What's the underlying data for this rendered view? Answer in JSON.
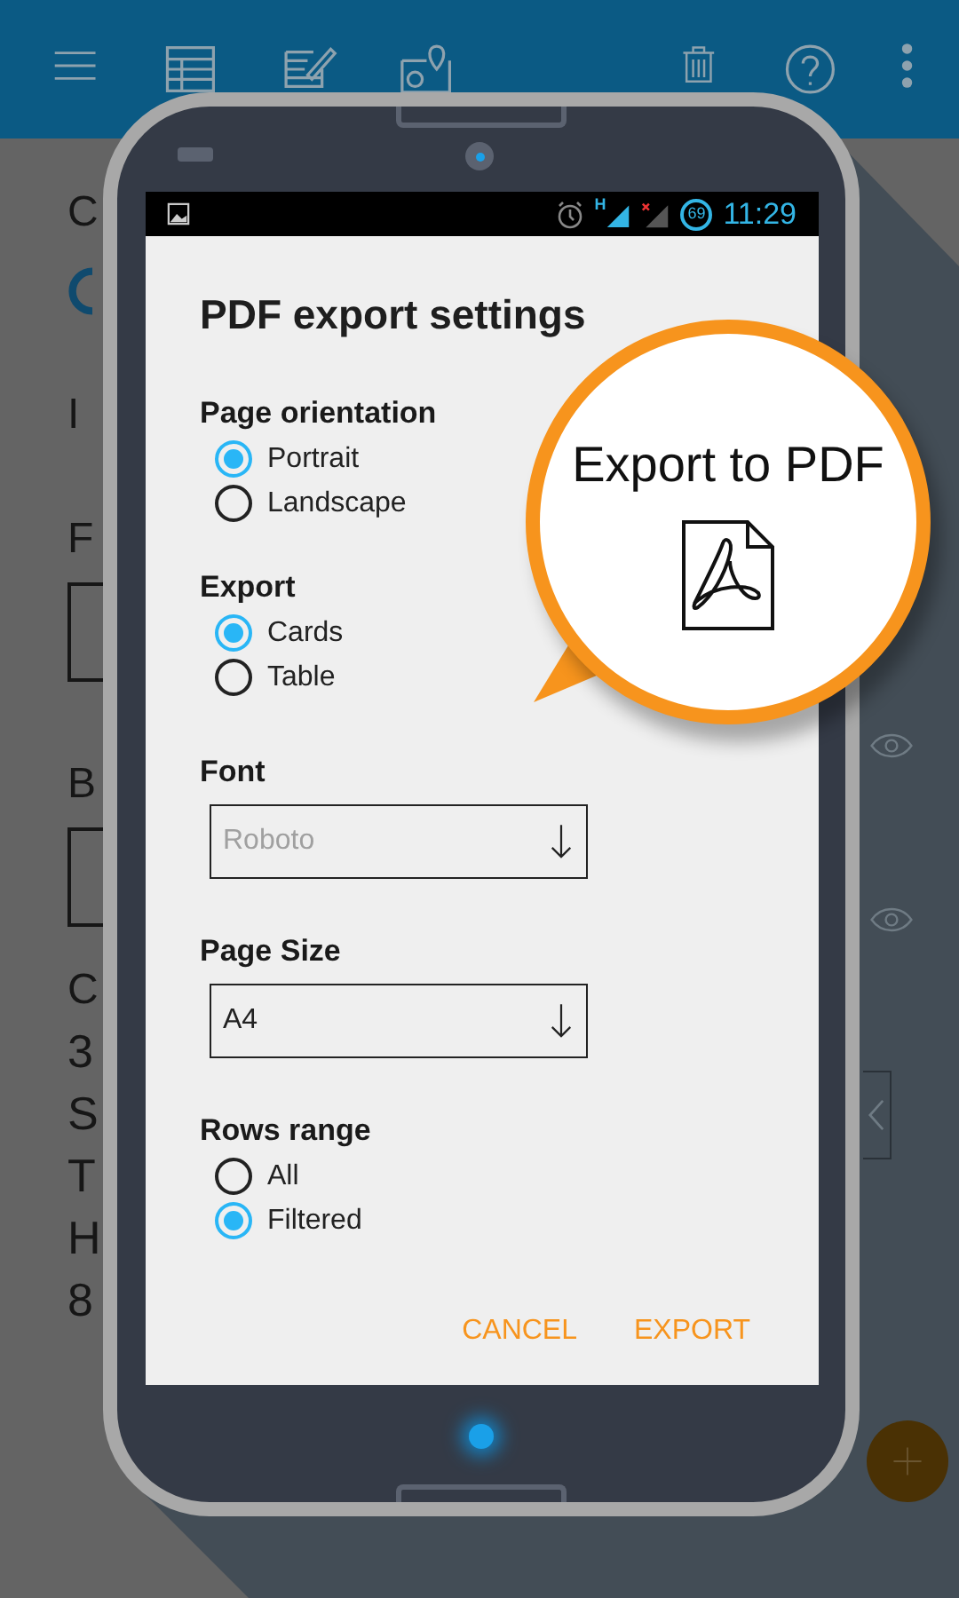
{
  "background": {
    "letters": [
      {
        "text": "C",
        "kind": "logo_label"
      },
      {
        "text": "I",
        "kind": "label"
      },
      {
        "text": "F",
        "kind": "field_label"
      },
      {
        "text": "B",
        "kind": "field_label"
      },
      {
        "text": "C",
        "kind": "label"
      },
      {
        "text": "3",
        "kind": "value"
      },
      {
        "text": "S",
        "kind": "value"
      },
      {
        "text": "T",
        "kind": "value"
      },
      {
        "text": "H",
        "kind": "value"
      },
      {
        "text": "8",
        "kind": "value"
      }
    ]
  },
  "status_bar": {
    "network": "H",
    "battery": "69",
    "time": "11:29"
  },
  "dialog": {
    "title": "PDF export settings",
    "sections": [
      {
        "kind": "radio",
        "label": "Page orientation",
        "options": [
          {
            "label": "Portrait",
            "selected": true
          },
          {
            "label": "Landscape",
            "selected": false
          }
        ]
      },
      {
        "kind": "radio",
        "label": "Export",
        "options": [
          {
            "label": "Cards",
            "selected": true
          },
          {
            "label": "Table",
            "selected": false
          }
        ]
      },
      {
        "kind": "dropdown",
        "label": "Font",
        "value": "Roboto",
        "disabled": true
      },
      {
        "kind": "dropdown",
        "label": "Page Size",
        "value": "A4",
        "disabled": false
      },
      {
        "kind": "radio",
        "label": "Rows range",
        "options": [
          {
            "label": "All",
            "selected": false
          },
          {
            "label": "Filtered",
            "selected": true
          }
        ]
      }
    ],
    "buttons": [
      "CANCEL",
      "EXPORT"
    ]
  },
  "callout": {
    "text": "Export to PDF"
  }
}
